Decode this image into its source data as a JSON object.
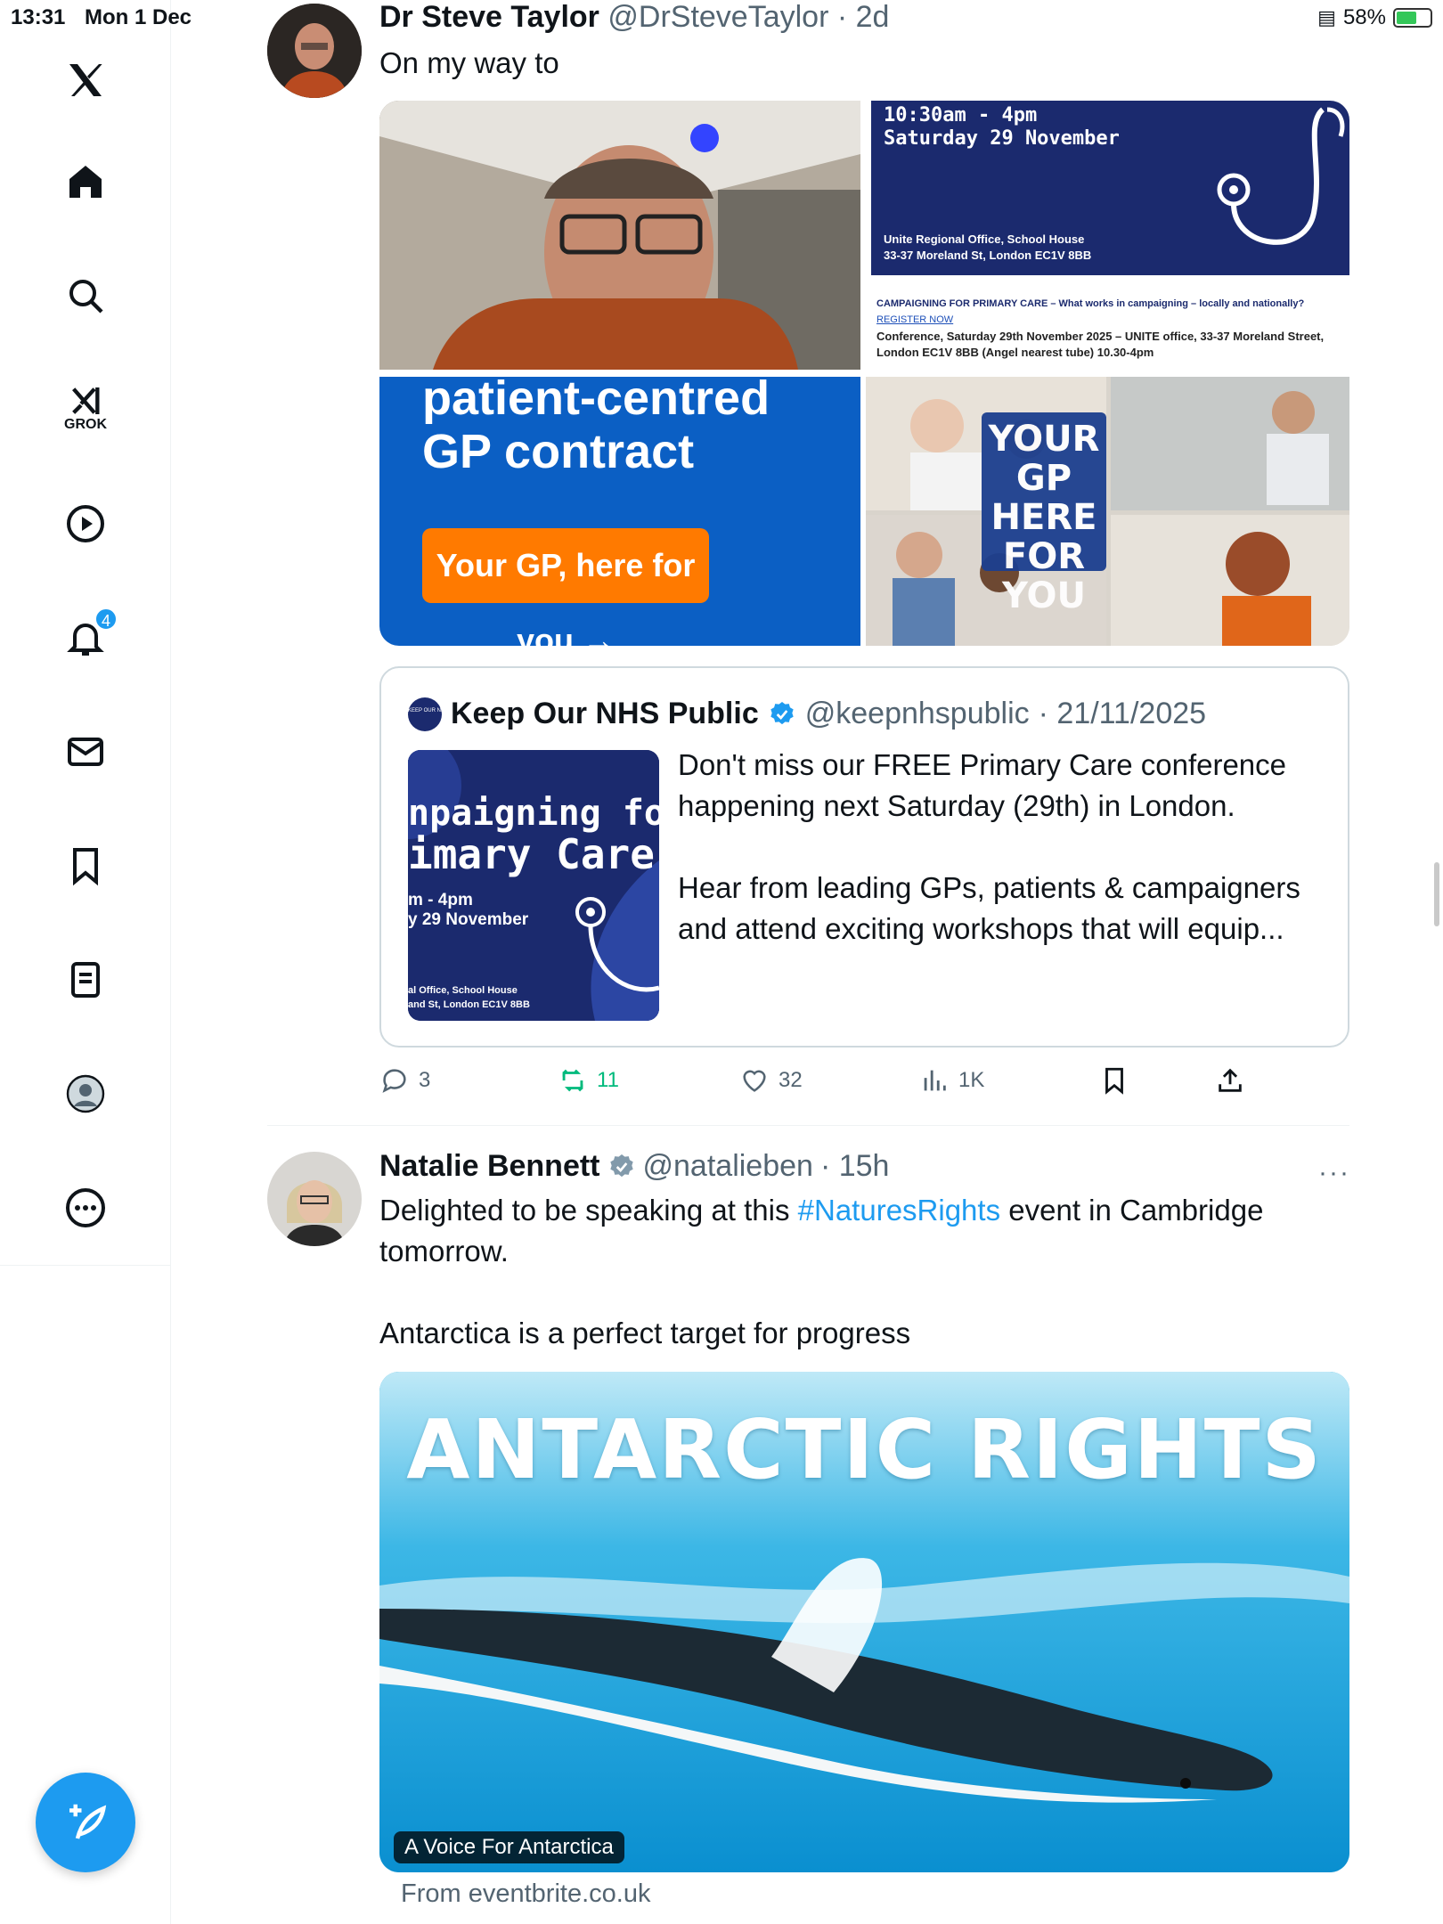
{
  "status_bar": {
    "time": "13:31",
    "date": "Mon 1 Dec",
    "battery": "58%"
  },
  "sidebar": {
    "grok_label": "GROK",
    "notification_count": "4",
    "icons": [
      "x-logo-icon",
      "home-icon",
      "search-icon",
      "grok-icon",
      "video-icon",
      "bell-icon",
      "mail-icon",
      "bookmark-icon",
      "lists-icon",
      "profile-icon",
      "more-icon",
      "compose-icon"
    ]
  },
  "tweet1": {
    "name": "Dr Steve Taylor",
    "handle": "@DrSteveTaylor",
    "time": "· 2d",
    "text": "On my way to",
    "media": {
      "poster_time": "10:30am - 4pm",
      "poster_date": "Saturday 29 November",
      "poster_address_1": "Unite Regional Office, School House",
      "poster_address_2": "33-37 Moreland St, London EC1V 8BB",
      "poster_headline": "CAMPAIGNING FOR PRIMARY CARE – What works in campaigning – locally and nationally?",
      "poster_register": "REGISTER NOW",
      "poster_details": "Conference, Saturday 29th November 2025 – UNITE office, 33-37 Moreland Street, London EC1V 8BB (Angel nearest tube) 10.30-4pm",
      "contract_title": "patient-centred GP contract",
      "contract_button": "Your GP, here for you →",
      "your_gp_label": "YOUR GP HERE FOR YOU"
    },
    "quote": {
      "name": "Keep Our NHS Public",
      "handle": "@keepnhspublic",
      "time": "· 21/11/2025",
      "avatar_text": "KEEP OUR NHS PUBLIC",
      "text_p1": "Don't miss our FREE Primary Care conference happening next Saturday (29th) in London.",
      "text_p2": "Hear from leading GPs, patients & campaigners and attend exciting workshops that will equip...",
      "thumb_line1": "npaigning for",
      "thumb_line2": "imary Care",
      "thumb_line3": "m - 4pm",
      "thumb_line4": "y 29 November",
      "thumb_line5": "al Office, School House",
      "thumb_line6": "and St, London EC1V 8BB"
    },
    "actions": {
      "replies": "3",
      "reposts": "11",
      "likes": "32",
      "views": "1K"
    }
  },
  "tweet2": {
    "name": "Natalie Bennett",
    "handle": "@natalieben",
    "time": "· 15h",
    "more": "···",
    "text_before_tag": "Delighted to be speaking at this ",
    "hashtag": "#NaturesRights",
    "text_after_tag": " event in Cambridge tomorrow.",
    "text_p2": "Antarctica is a perfect target for progress",
    "image_title": "ANTARCTIC RIGHTS",
    "image_caption": "A Voice For Antarctica",
    "source": "From eventbrite.co.uk"
  },
  "colors": {
    "accent": "#1d9bf0",
    "repost": "#00ba7c",
    "text": "#0f1419",
    "muted": "#536471",
    "nhs_navy": "#1b2a6e",
    "nhs_blue": "#0b5fc4",
    "orange": "#ff7a00"
  }
}
